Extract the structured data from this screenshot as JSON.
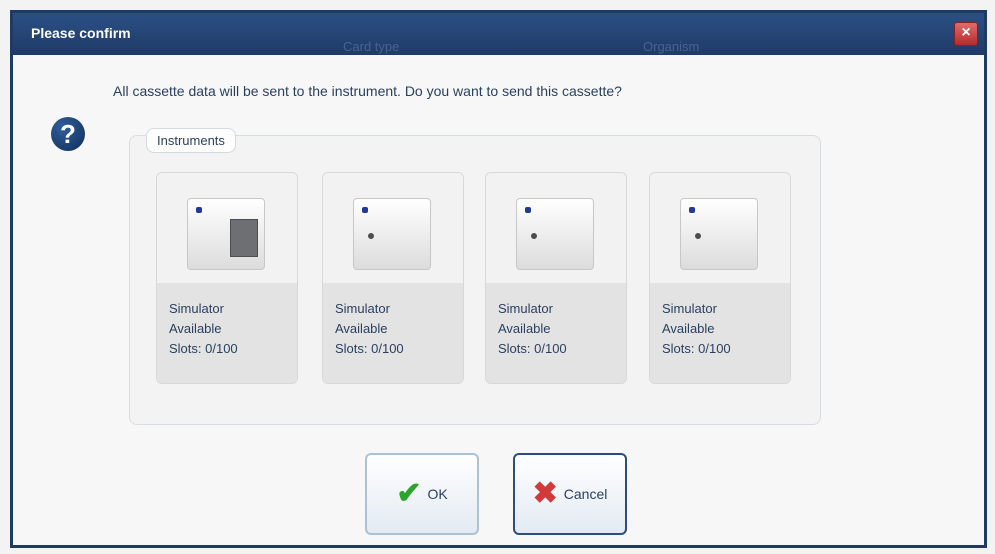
{
  "dialog": {
    "title": "Please confirm",
    "background_texts": [
      "Card type",
      "Organism"
    ],
    "close_icon": "close-icon",
    "message": "All cassette data will be sent to the instrument. Do you want to send this cassette?",
    "question_icon": "question-icon",
    "group_label": "Instruments",
    "instruments": [
      {
        "name": "Simulator",
        "status": "Available",
        "slots": "Slots: 0/100"
      },
      {
        "name": "Simulator",
        "status": "Available",
        "slots": "Slots: 0/100"
      },
      {
        "name": "Simulator",
        "status": "Available",
        "slots": "Slots: 0/100"
      },
      {
        "name": "Simulator",
        "status": "Available",
        "slots": "Slots: 0/100"
      }
    ],
    "buttons": {
      "ok": "OK",
      "cancel": "Cancel"
    }
  },
  "colors": {
    "titlebar": "#1f3b67",
    "ok_check": "#2aa52a",
    "cancel_x": "#d23a3a"
  }
}
